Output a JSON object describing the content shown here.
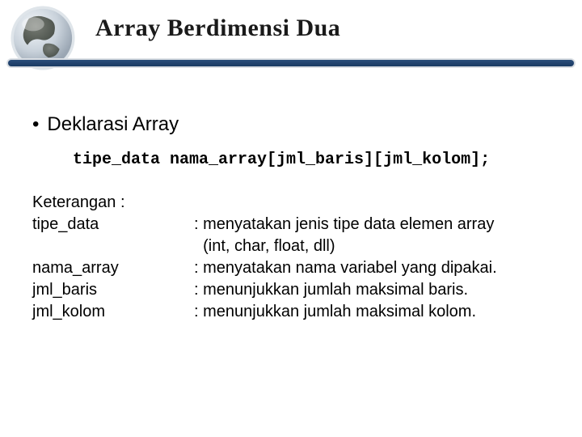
{
  "title": "Array Berdimensi Dua",
  "bullet": "Deklarasi Array",
  "code": "tipe_data nama_array[jml_baris][jml_kolom];",
  "keterangan_label": "Keterangan :",
  "rows": [
    {
      "term": "tipe_data",
      "def1": ": menyatakan jenis tipe data elemen array",
      "def2": "  (int, char, float, dll)"
    },
    {
      "term": "nama_array",
      "def1": ": menyatakan nama variabel yang dipakai.",
      "def2": ""
    },
    {
      "term": "jml_baris",
      "def1": ": menunjukkan jumlah maksimal baris.",
      "def2": ""
    },
    {
      "term": "jml_kolom",
      "def1": ": menunjukkan jumlah maksimal kolom.",
      "def2": ""
    }
  ]
}
